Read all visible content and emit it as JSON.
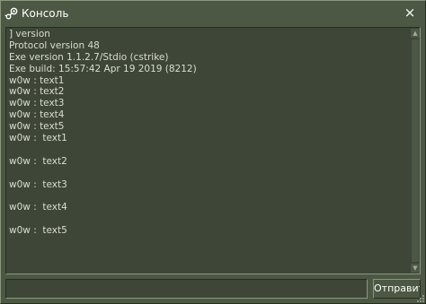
{
  "window": {
    "title": "Консоль",
    "close_label": "×",
    "icon": "steam-icon"
  },
  "console": {
    "lines": [
      "] version",
      "Protocol version 48",
      "Exe version 1.1.2.7/Stdio (cstrike)",
      "Exe build: 15:57:42 Apr 19 2019 (8212)",
      "w0w : text1",
      "w0w : text2",
      "w0w : text3",
      "w0w : text4",
      "w0w : text5",
      "w0w :  text1",
      "",
      "w0w :  text2",
      "",
      "w0w :  text3",
      "",
      "w0w :  text4",
      "",
      "w0w :  text5"
    ]
  },
  "input": {
    "value": "",
    "placeholder": ""
  },
  "submit_label": "Отправить",
  "colors": {
    "window_bg": "#4c5844",
    "panel_bg": "#3e4637",
    "text": "#d8ded3",
    "title_text": "#ffffff",
    "border_light": "#8c9680",
    "border_dark": "#292c21"
  }
}
